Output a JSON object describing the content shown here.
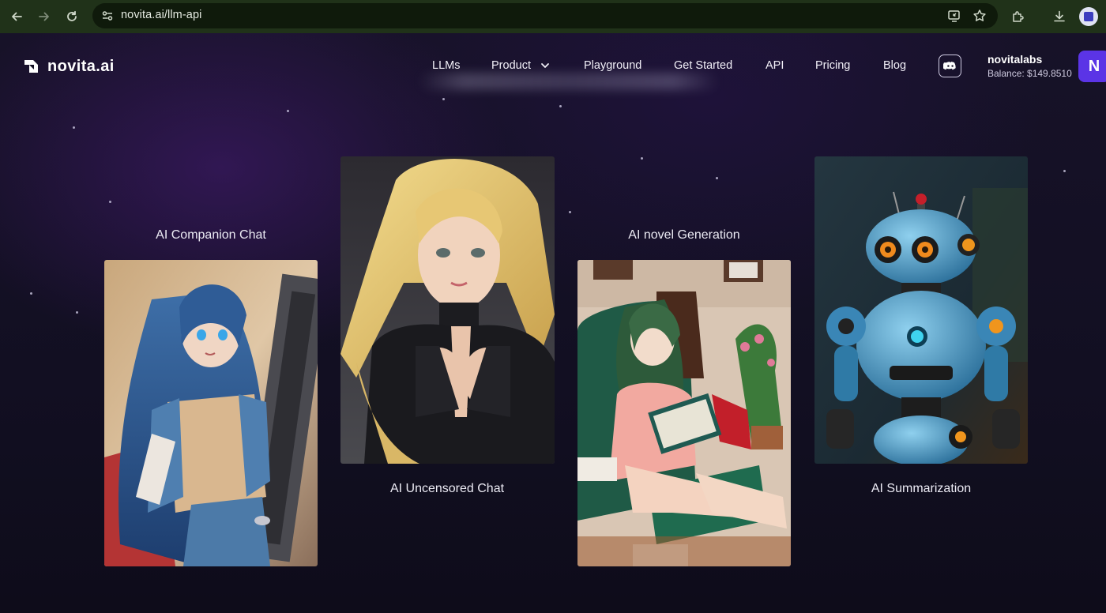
{
  "browser": {
    "url": "novita.ai/llm-api",
    "back_icon": "arrow-left-icon",
    "forward_icon": "arrow-right-icon",
    "reload_icon": "reload-icon",
    "site_info_icon": "tune-icon",
    "install_icon": "install-app-icon",
    "bookmark_icon": "star-icon",
    "extensions_icon": "puzzle-icon",
    "download_icon": "download-icon",
    "profile_icon": "profile-icon"
  },
  "header": {
    "logo_text": "novita.ai",
    "nav": {
      "llms": "LLMs",
      "product": "Product",
      "playground": "Playground",
      "get_started": "Get Started",
      "api": "API",
      "pricing": "Pricing",
      "blog": "Blog"
    },
    "user": {
      "name": "novitalabs",
      "balance": "Balance: $149.8510",
      "avatar_letter": "N"
    }
  },
  "cards": [
    {
      "label": "AI Companion Chat"
    },
    {
      "label": "AI Uncensored Chat"
    },
    {
      "label": "AI novel Generation"
    },
    {
      "label": "AI Summarization"
    }
  ],
  "colors": {
    "chrome_bg": "#203219",
    "page_bg": "#120f22",
    "avatar_bg": "#5b34e6"
  }
}
